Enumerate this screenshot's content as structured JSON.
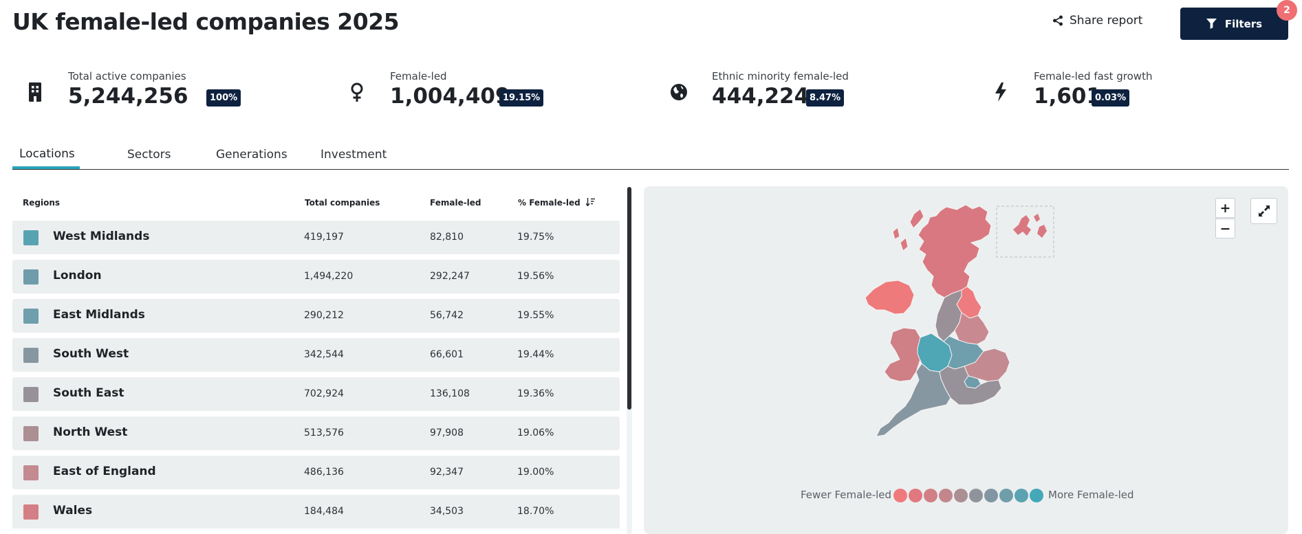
{
  "header": {
    "title": "UK female-led companies 2025",
    "share_label": "Share report",
    "filters_label": "Filters",
    "filters_count": "2"
  },
  "stats": [
    {
      "label": "Total active companies",
      "value": "5,244,256",
      "pct": "100%",
      "icon": "building-icon"
    },
    {
      "label": "Female-led",
      "value": "1,004,409",
      "pct": "19.15%",
      "icon": "female-icon"
    },
    {
      "label": "Ethnic minority female-led",
      "value": "444,224",
      "pct": "8.47%",
      "icon": "globe-icon"
    },
    {
      "label": "Female-led fast growth",
      "value": "1,601",
      "pct": "0.03%",
      "icon": "lightning-icon"
    }
  ],
  "tabs": [
    {
      "label": "Locations",
      "active": true
    },
    {
      "label": "Sectors",
      "active": false
    },
    {
      "label": "Generations",
      "active": false
    },
    {
      "label": "Investment",
      "active": false
    }
  ],
  "table": {
    "headers": {
      "region": "Regions",
      "total": "Total companies",
      "female": "Female-led",
      "pct": "% Female-led"
    },
    "rows": [
      {
        "region": "West Midlands",
        "total": "419,197",
        "female": "82,810",
        "pct": "19.75%",
        "color": "#58a3b1"
      },
      {
        "region": "London",
        "total": "1,494,220",
        "female": "292,247",
        "pct": "19.56%",
        "color": "#6e9caa"
      },
      {
        "region": "East Midlands",
        "total": "290,212",
        "female": "56,742",
        "pct": "19.55%",
        "color": "#6f9eac"
      },
      {
        "region": "South West",
        "total": "342,544",
        "female": "66,601",
        "pct": "19.44%",
        "color": "#8797a1"
      },
      {
        "region": "South East",
        "total": "702,924",
        "female": "136,108",
        "pct": "19.36%",
        "color": "#979199"
      },
      {
        "region": "North West",
        "total": "513,576",
        "female": "97,908",
        "pct": "19.06%",
        "color": "#ab8f93"
      },
      {
        "region": "East of England",
        "total": "486,136",
        "female": "92,347",
        "pct": "19.00%",
        "color": "#c38b91"
      },
      {
        "region": "Wales",
        "total": "184,484",
        "female": "34,503",
        "pct": "18.70%",
        "color": "#d47f86"
      }
    ]
  },
  "map": {
    "zoom_in": "+",
    "zoom_out": "−",
    "legend_low": "Fewer Female-led",
    "legend_high": "More Female-led",
    "legend_colors": [
      "#ee7a7c",
      "#e0787f",
      "#d27f86",
      "#c3868d",
      "#ab8f94",
      "#8f949c",
      "#8196a2",
      "#6f9daa",
      "#5ba3b2",
      "#45a8b8"
    ],
    "region_colors": {
      "scotland": "#d97880",
      "northern_ireland": "#ef7a7b",
      "north_east": "#ee7b7e",
      "north_west": "#9a9097",
      "yorkshire": "#c98990",
      "east_midlands": "#6f9eac",
      "west_midlands": "#4fa6b5",
      "wales": "#cf7f86",
      "east_of_england": "#c38b91",
      "london": "#6e9caa",
      "south_east": "#979199",
      "south_west": "#8797a1"
    }
  }
}
